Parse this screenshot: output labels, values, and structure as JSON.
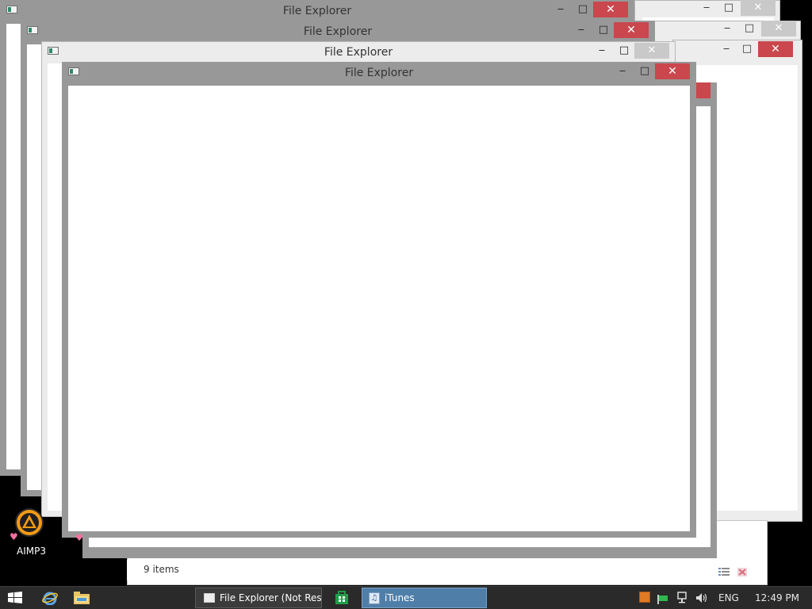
{
  "windows": [
    {
      "title": "File Explorer",
      "minimize_glyph": "‒",
      "maximize_glyph": "□",
      "close_glyph": "✕"
    },
    {
      "title": "File Explorer",
      "minimize_glyph": "‒",
      "maximize_glyph": "□",
      "close_glyph": "✕"
    },
    {
      "title": "File Explorer",
      "minimize_glyph": "‒",
      "maximize_glyph": "□",
      "close_glyph": "✕"
    },
    {
      "title": "File Explorer",
      "minimize_glyph": "‒",
      "maximize_glyph": "□",
      "close_glyph": "✕"
    }
  ],
  "explorer_status": {
    "items": "9 items"
  },
  "desktop": {
    "icons": [
      {
        "label": "AIMP3",
        "icon": "aimp-icon"
      }
    ]
  },
  "taskbar": {
    "buttons": [
      {
        "label": "File Explorer (Not Res...",
        "icon": "window-icon"
      },
      {
        "label": "iTunes",
        "icon": "itunes-icon"
      }
    ],
    "pinned": [
      "start-icon",
      "internet-explorer-icon",
      "folder-icon",
      "store-icon"
    ],
    "tray": {
      "language": "ENG",
      "clock": "12:49 PM"
    }
  },
  "colors": {
    "close_red": "#c9474d",
    "frame_gray": "#989898",
    "frame_light": "#ececec",
    "taskbar": "#2a2a2a",
    "active_task": "#4f7fa8"
  }
}
